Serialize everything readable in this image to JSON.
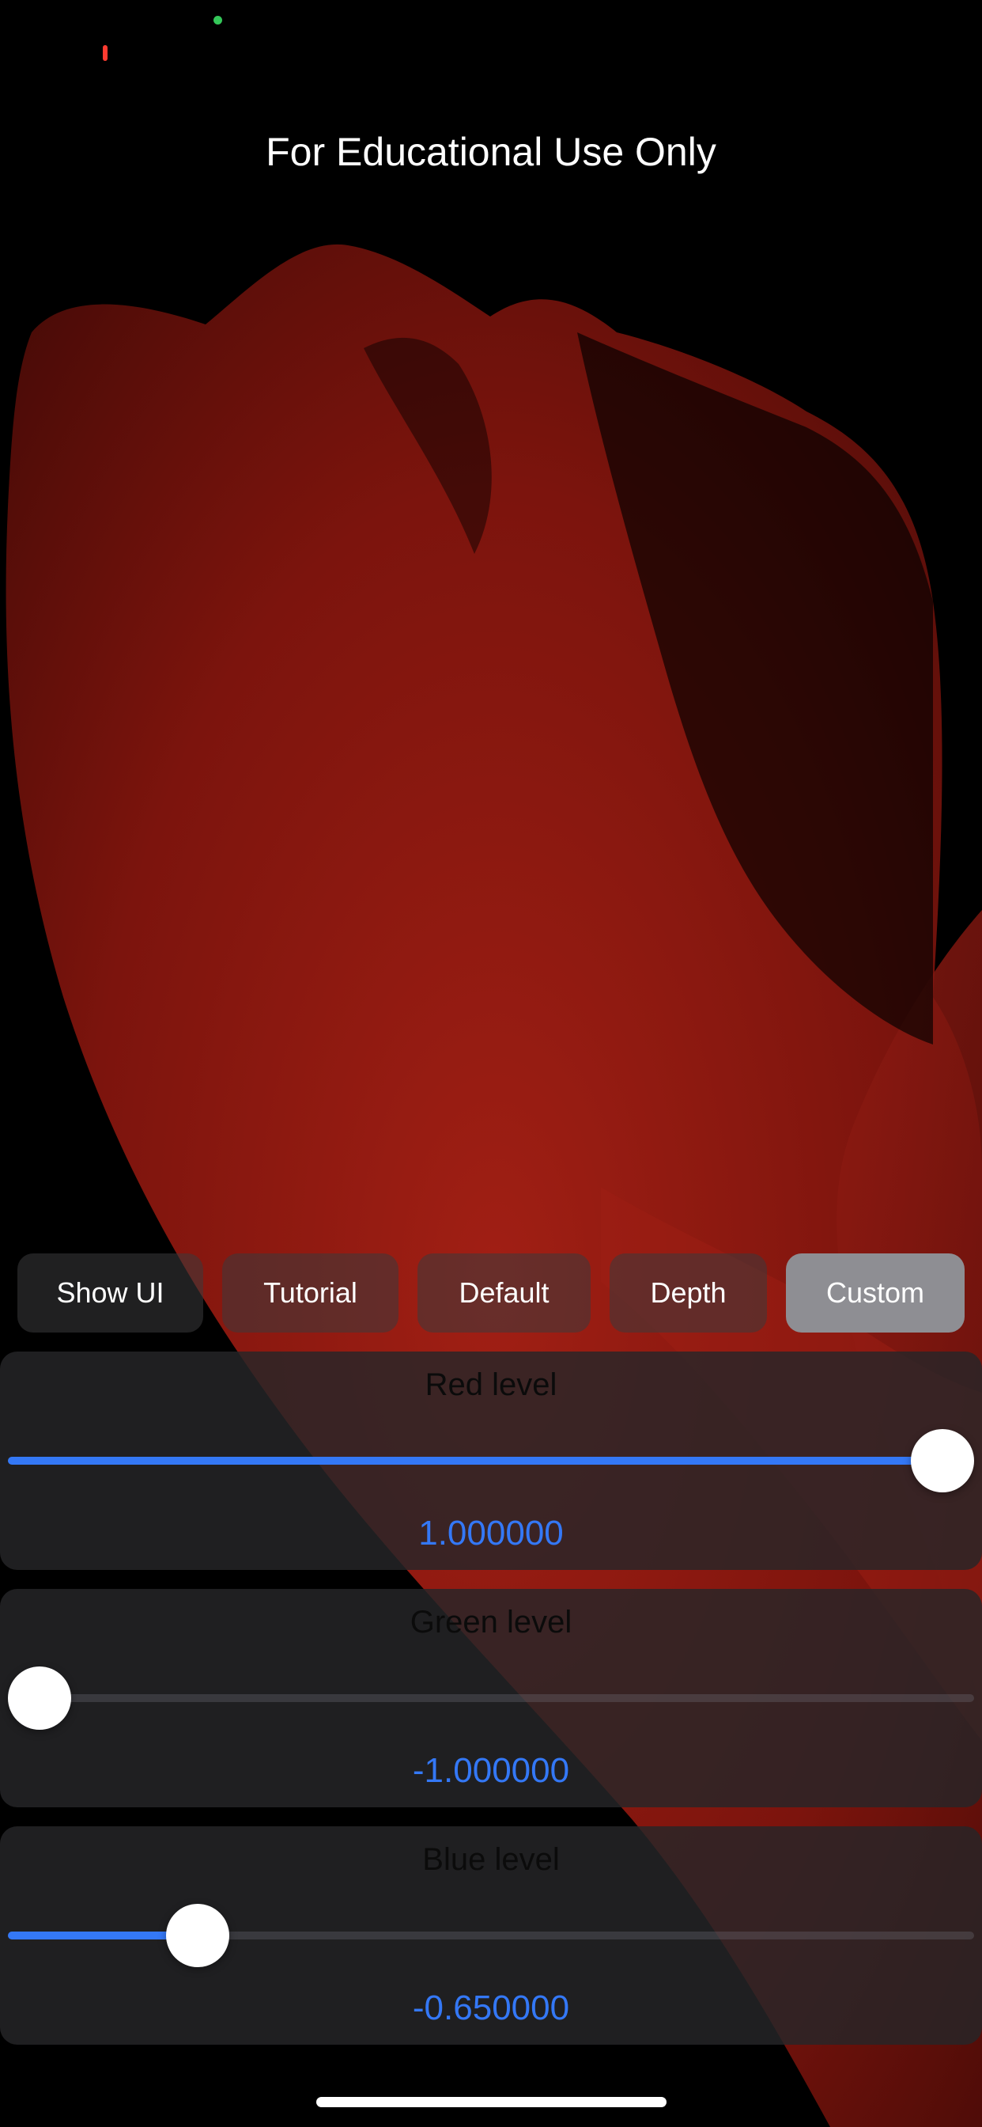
{
  "header": {
    "title": "For Educational Use Only"
  },
  "status": {
    "camera_indicator_color": "#34c759",
    "recording_indicator_color": "#ff3b30"
  },
  "toolbar": {
    "buttons": [
      {
        "label": "Show UI",
        "active": false
      },
      {
        "label": "Tutorial",
        "active": false
      },
      {
        "label": "Default",
        "active": false
      },
      {
        "label": "Depth",
        "active": false
      },
      {
        "label": "Custom",
        "active": true
      }
    ]
  },
  "sliders": [
    {
      "label": "Red level",
      "value_text": "1.000000",
      "value": 1.0,
      "min": -1.0,
      "max": 1.0
    },
    {
      "label": "Green level",
      "value_text": "-1.000000",
      "value": -1.0,
      "min": -1.0,
      "max": 1.0
    },
    {
      "label": "Blue level",
      "value_text": "-0.650000",
      "value": -0.65,
      "min": -1.0,
      "max": 1.0
    }
  ],
  "theme": {
    "accent": "#3478f6",
    "background": "#000000",
    "image_tint": "#8b1a12"
  }
}
